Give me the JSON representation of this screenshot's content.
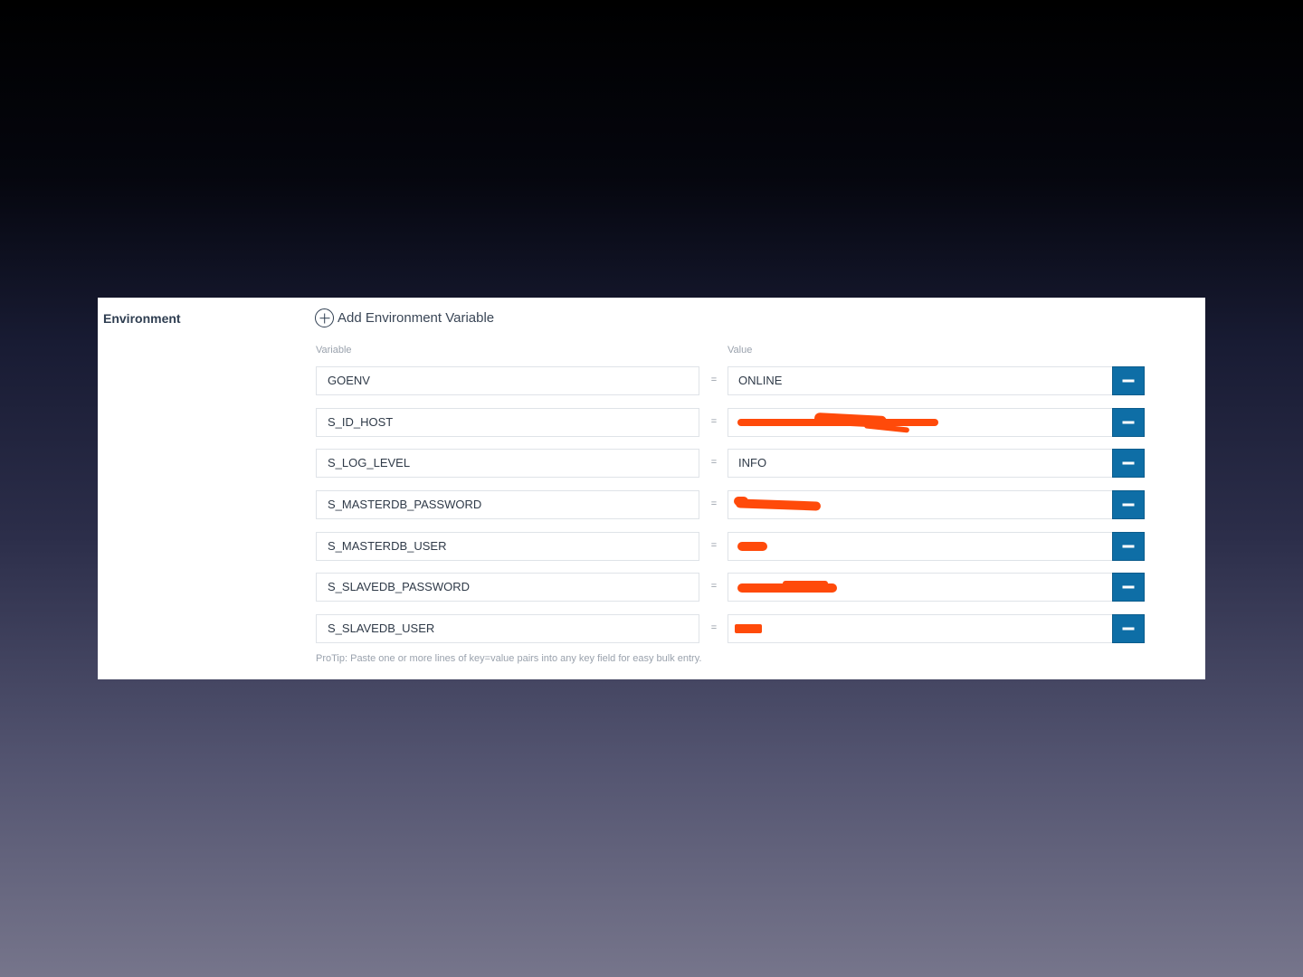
{
  "environment": {
    "section_label": "Environment",
    "add_button_label": "Add Environment Variable",
    "add_icon": "plus-circle-icon",
    "remove_icon": "minus-icon",
    "column_headers": {
      "variable": "Variable",
      "value": "Value"
    },
    "equals_sign": "=",
    "variables": [
      {
        "key": "GOENV",
        "value": "ONLINE",
        "redacted": false
      },
      {
        "key": "S_ID_HOST",
        "value": "",
        "redacted": true
      },
      {
        "key": "S_LOG_LEVEL",
        "value": "INFO",
        "redacted": false
      },
      {
        "key": "S_MASTERDB_PASSWORD",
        "value": "",
        "redacted": true
      },
      {
        "key": "S_MASTERDB_USER",
        "value": "",
        "redacted": true
      },
      {
        "key": "S_SLAVEDB_PASSWORD",
        "value": "",
        "redacted": true
      },
      {
        "key": "S_SLAVEDB_USER",
        "value": "",
        "redacted": true
      }
    ],
    "protip": "ProTip: Paste one or more lines of key=value pairs into any key field for easy bulk entry."
  },
  "colors": {
    "remove_button": "#0e6ea6",
    "redaction_mark": "#ff4a0a"
  }
}
